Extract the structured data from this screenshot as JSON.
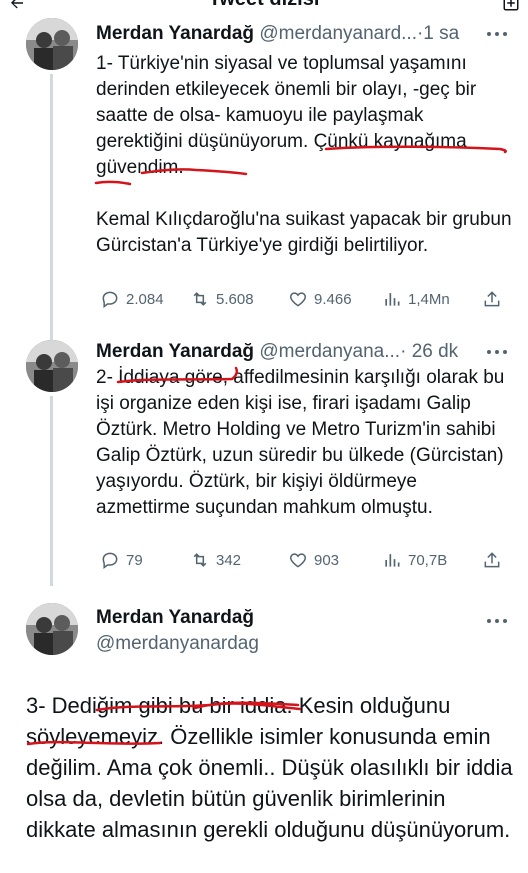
{
  "topbar": {
    "title": "Tweet dizisi",
    "back_icon": "arrow-left-icon",
    "right_icon": "compose-icon"
  },
  "tweets": [
    {
      "author": "Merdan Yanardağ",
      "handle": "@merdanyanard...",
      "separator": "·",
      "time": "1 sa",
      "paragraph1": "1- Türkiye'nin siyasal ve toplumsal yaşamını derinden etkileyecek önemli bir olayı, -geç bir saatte de olsa- kamuoyu ile paylaşmak gerektiğini düşünüyorum. Çünkü kaynağıma güvendim.",
      "paragraph2": "Kemal Kılıçdaroğlu'na suikast yapacak bir grubun Gürcistan'a Türkiye'ye girdiği belirtiliyor.",
      "replies": "2.084",
      "retweets": "5.608",
      "likes": "9.466",
      "views": "1,4Mn"
    },
    {
      "author": "Merdan Yanardağ",
      "handle": "@merdanyana...",
      "separator": "·",
      "time": "26 dk",
      "paragraph1": "2- İddiaya göre, affedilmesinin karşılığı olarak bu işi organize eden kişi ise, firari işadamı Galip Öztürk.  Metro Holding ve Metro Turizm'in sahibi Galip Öztürk, uzun süredir bu ülkede (Gürcistan) yaşıyordu. Öztürk, bir kişiyi öldürmeye azmettirme suçundan mahkum olmuştu.",
      "replies": "79",
      "retweets": "342",
      "likes": "903",
      "views": "70,7B"
    },
    {
      "author": "Merdan Yanardağ",
      "handle": "@merdanyanardag",
      "paragraph1": "3- Dediğim gibi bu bir iddia. Kesin olduğunu söyleyemeyiz. Özellikle isimler konusunda emin değilim. Ama çok önemli.. Düşük olasılıklı bir iddia olsa da, devletin bütün güvenlik birimlerinin dikkate almasının gerekli olduğunu düşünüyorum."
    }
  ],
  "colors": {
    "text": "#0f1419",
    "secondary": "#536471",
    "thread_line": "#cfd9de",
    "annotation": "#d4141b"
  },
  "icons": [
    "reply-icon",
    "retweet-icon",
    "like-icon",
    "views-icon",
    "share-icon",
    "more-icon"
  ]
}
